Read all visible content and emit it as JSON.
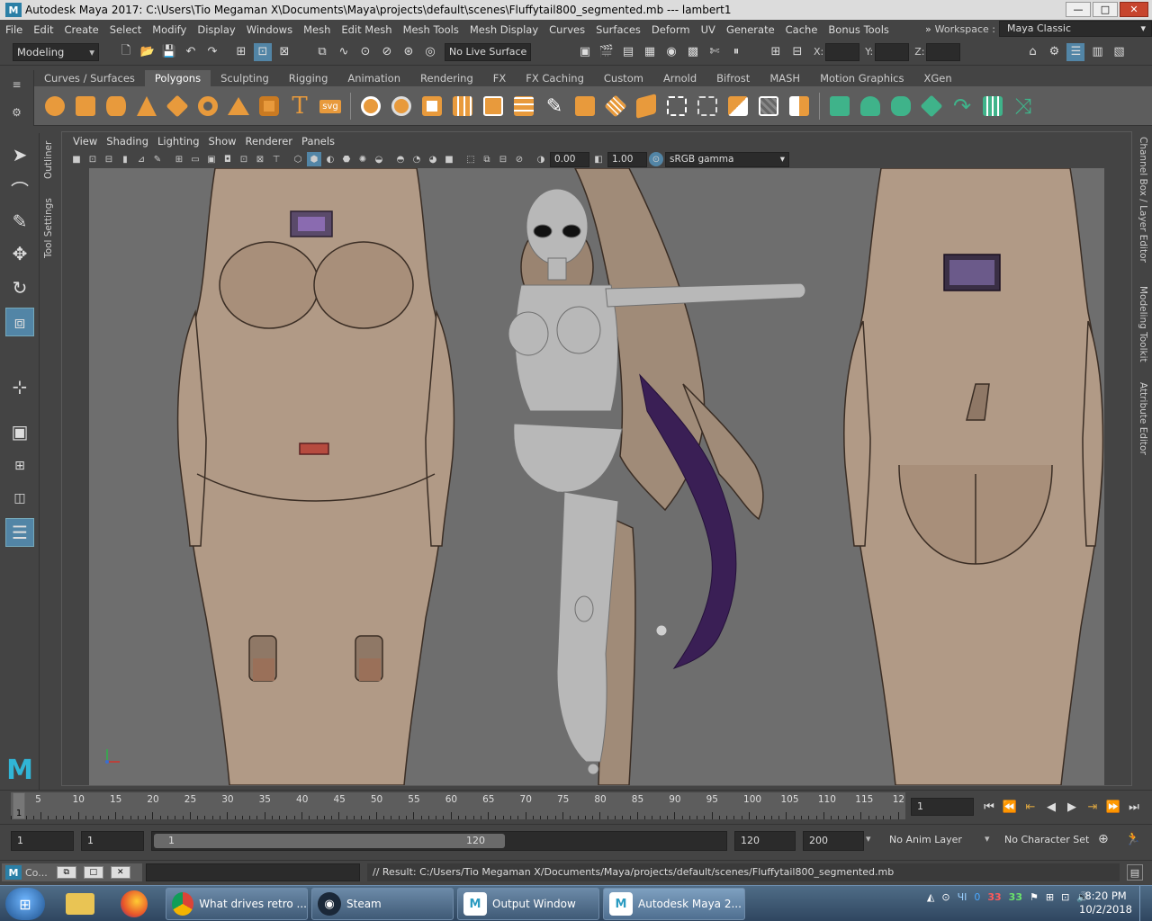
{
  "window": {
    "app_icon": "M",
    "title": "Autodesk Maya 2017: C:\\Users\\Tio Megaman X\\Documents\\Maya\\projects\\default\\scenes\\Fluffytail800_segmented.mb  ---   lambert1",
    "minimize_icon": "minimize-icon",
    "maximize_icon": "maximize-icon",
    "close_icon": "close-icon"
  },
  "menubar": {
    "items": [
      "File",
      "Edit",
      "Create",
      "Select",
      "Modify",
      "Display",
      "Windows",
      "Mesh",
      "Edit Mesh",
      "Mesh Tools",
      "Mesh Display",
      "Curves",
      "Surfaces",
      "Deform",
      "UV",
      "Generate",
      "Cache",
      "Bonus Tools"
    ],
    "workspace_label": "Workspace :",
    "workspace_value": "Maya Classic"
  },
  "statusline": {
    "mode": "Modeling",
    "live_surface": "No Live Surface",
    "x_label": "X:",
    "y_label": "Y:",
    "z_label": "Z:"
  },
  "shelf": {
    "tabs": [
      "Curves / Surfaces",
      "Polygons",
      "Sculpting",
      "Rigging",
      "Animation",
      "Rendering",
      "FX",
      "FX Caching",
      "Custom",
      "Arnold",
      "Bifrost",
      "MASH",
      "Motion Graphics",
      "XGen"
    ],
    "active_tab": "Polygons",
    "text_icon": "T",
    "svg_icon": "svg"
  },
  "side_tabs": {
    "left": [
      "Outliner",
      "Tool Settings"
    ],
    "right": [
      "Channel Box / Layer Editor",
      "Modeling Toolkit",
      "Attribute Editor"
    ]
  },
  "panel": {
    "menus": [
      "View",
      "Shading",
      "Lighting",
      "Show",
      "Renderer",
      "Panels"
    ],
    "exposure": "0.00",
    "gamma": "1.00",
    "color_space": "sRGB gamma"
  },
  "timeline": {
    "ticks": [
      "5",
      "10",
      "15",
      "20",
      "25",
      "30",
      "35",
      "40",
      "45",
      "50",
      "55",
      "60",
      "65",
      "70",
      "75",
      "80",
      "85",
      "90",
      "95",
      "100",
      "105",
      "110",
      "115",
      "12"
    ],
    "current_frame": "1",
    "frame_field": "1"
  },
  "range": {
    "start_field": "1",
    "playback_start": "1",
    "handle_start": "1",
    "handle_end": "120",
    "playback_end": "120",
    "end_field": "200",
    "anim_layer": "No Anim Layer",
    "character_set": "No Character Set"
  },
  "cmdline": {
    "tab_label": "Co...",
    "result": "// Result: C:/Users/Tio Megaman X/Documents/Maya/projects/default/scenes/Fluffytail800_segmented.mb"
  },
  "taskbar": {
    "buttons": [
      {
        "label": "What drives retro ...",
        "icon": "chrome-icon"
      },
      {
        "label": "Steam",
        "icon": "steam-icon"
      },
      {
        "label": "Output Window",
        "icon": "maya-icon"
      },
      {
        "label": "Autodesk Maya 2...",
        "icon": "maya-icon"
      }
    ],
    "tray_values": [
      "0",
      "33",
      "33"
    ],
    "tray_text": "ЧІ",
    "time": "8:20 PM",
    "date": "10/2/2018"
  },
  "colors": {
    "accent": "#5285a6",
    "viewport_bg": "#6e6e6e",
    "maya_logo": "#31b5d6",
    "tail": "#3a1f55"
  }
}
